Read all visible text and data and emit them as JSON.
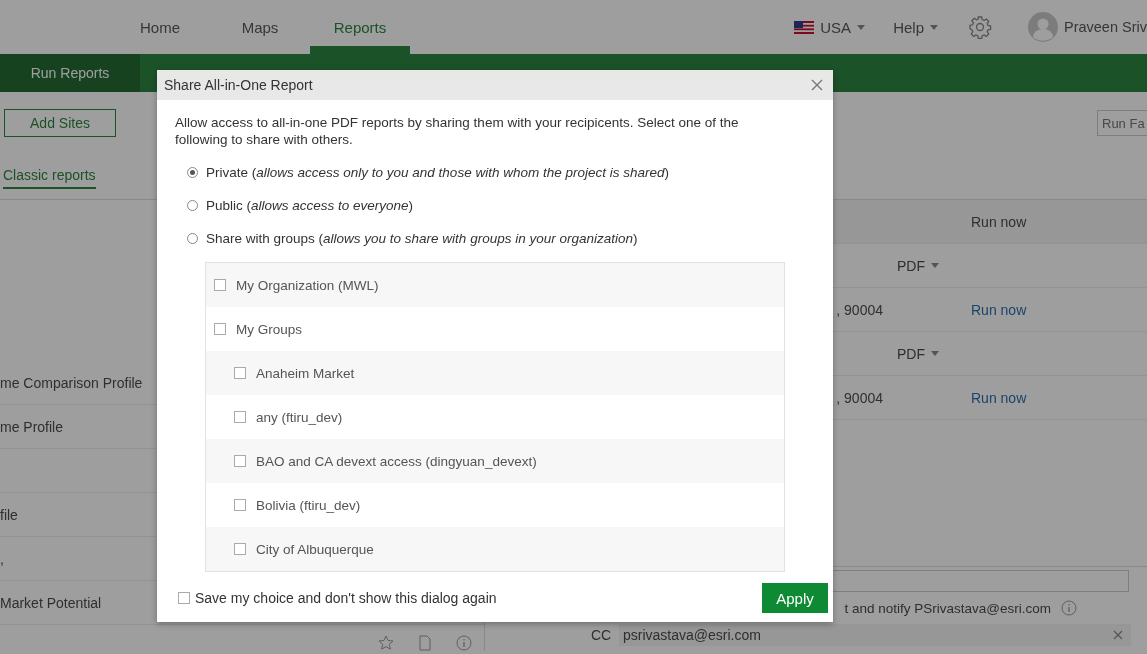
{
  "nav": {
    "items": [
      {
        "label": "Home",
        "selected": false
      },
      {
        "label": "Maps",
        "selected": false
      },
      {
        "label": "Reports",
        "selected": true
      }
    ],
    "country": "USA",
    "help": "Help",
    "user": "Praveen Sriv"
  },
  "subnav": {
    "tabs": [
      {
        "label": "Run Reports",
        "selected": true
      }
    ]
  },
  "toolbar": {
    "add_button": "Add Sites",
    "search": {
      "placeholder": "Run Fa"
    }
  },
  "view_tabs": [
    {
      "label": "Classic reports",
      "selected": true
    }
  ],
  "left_rows": [
    {
      "label": "me Comparison Profile"
    },
    {
      "label": "me Profile"
    },
    {},
    {
      "label": "file"
    },
    {
      "label": ","
    },
    {
      "label": "Market Potential"
    }
  ],
  "right_table": {
    "header": "Run now",
    "rows": [
      {
        "format": "PDF"
      },
      {
        "address": ", 90004",
        "action": "Run now"
      },
      {
        "format": "PDF"
      },
      {
        "address": ", 90004",
        "action": "Run now"
      }
    ]
  },
  "notify": {
    "text": "t and notify PSrivastava@esri.com",
    "cc_label": "CC",
    "cc_value": "psrivastava@esri.com"
  },
  "dialog": {
    "title": "Share All-in-One Report",
    "description": "Allow access to all-in-one PDF reports by sharing them with your recipicents. Select one of the following to share with others.",
    "options": [
      {
        "label": "Private (*allows access only to you and those with whom the project is shared*)",
        "selected": true
      },
      {
        "label": "Public (*allows access to everyone*)",
        "selected": false
      },
      {
        "label": "Share with groups (*allows you to share with groups in your organization*)",
        "selected": false
      }
    ],
    "groups": [
      {
        "label": "My Organization (MWL)",
        "checked": false
      },
      {
        "label": "My Groups",
        "checked": false,
        "children": [
          {
            "label": "Anaheim Market",
            "checked": false
          },
          {
            "label": "any (ftiru_dev)",
            "checked": false
          },
          {
            "label": "BAO and CA devext access (dingyuan_devext)",
            "checked": false
          },
          {
            "label": "Bolivia (ftiru_dev)",
            "checked": false
          },
          {
            "label": "City of Albuquerque",
            "checked": false
          }
        ]
      }
    ],
    "remember": {
      "label": "Save my choice and don't show this dialog again",
      "checked": false
    },
    "apply": "Apply"
  }
}
